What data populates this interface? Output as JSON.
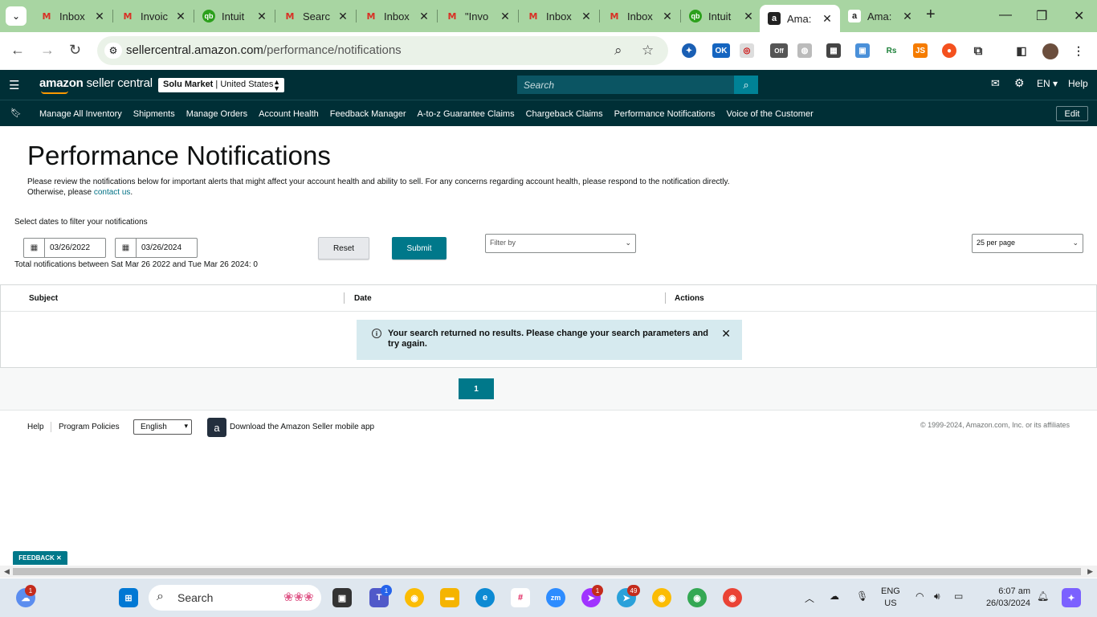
{
  "browser": {
    "tabs": [
      {
        "title": "Inbox",
        "favicon": "gmail-icon"
      },
      {
        "title": "Invoic",
        "favicon": "gmail-icon"
      },
      {
        "title": "Intuit",
        "favicon": "quickbooks-icon"
      },
      {
        "title": "Searc",
        "favicon": "gmail-icon"
      },
      {
        "title": "Inbox",
        "favicon": "gmail-icon"
      },
      {
        "title": "\"Invo",
        "favicon": "gmail-icon"
      },
      {
        "title": "Inbox",
        "favicon": "gmail-icon"
      },
      {
        "title": "Inbox",
        "favicon": "gmail-icon"
      },
      {
        "title": "Intuit",
        "favicon": "quickbooks-icon"
      },
      {
        "title": "Ama:",
        "favicon": "amazon-icon",
        "active": true
      },
      {
        "title": "Ama:",
        "favicon": "amazon-icon"
      }
    ],
    "url_domain": "sellercentral.amazon.com",
    "url_path": "/performance/notifications",
    "accent_color": "#a8d5a2"
  },
  "header": {
    "logo_bold": "amazon",
    "logo_rest": " seller central",
    "market_bold": "Solu Market",
    "market_sep": " | ",
    "market_region": "United States",
    "search_placeholder": "Search",
    "lang": "EN",
    "help": "Help",
    "bg_color": "#002f36"
  },
  "nav": {
    "links": [
      "Manage All Inventory",
      "Shipments",
      "Manage Orders",
      "Account Health",
      "Feedback Manager",
      "A-to-z Guarantee Claims",
      "Chargeback Claims",
      "Performance Notifications",
      "Voice of the Customer"
    ],
    "edit": "Edit"
  },
  "page": {
    "title": "Performance Notifications",
    "intro": "Please review the notifications below for important alerts that might affect your account health and ability to sell. For any concerns regarding account health, please respond to the notification directly. Otherwise, please ",
    "intro_link": "contact us",
    "intro_end": ".",
    "date_label": "Select dates to filter your notifications",
    "date_from": "03/26/2022",
    "date_to": "03/26/2024",
    "total": "Total notifications between Sat Mar 26 2022 and Tue Mar 26 2024: 0",
    "reset": "Reset",
    "submit": "Submit",
    "filter_placeholder": "Filter by",
    "per_page": "25 per page",
    "columns": [
      "Subject",
      "Date",
      "Actions"
    ],
    "no_results": "Your search returned no results. Please change your search parameters and try again.",
    "current_page": "1",
    "accent_color": "#00788a"
  },
  "footer": {
    "help": "Help",
    "policies": "Program Policies",
    "language": "English",
    "app_text": "Download the Amazon Seller mobile app",
    "copyright": "© 1999-2024, Amazon.com, Inc. or its affiliates",
    "feedback": "FEEDBACK"
  },
  "taskbar": {
    "search": "Search",
    "lang_top": "ENG",
    "lang_bottom": "US",
    "time": "6:07 am",
    "date": "26/03/2024",
    "badges": {
      "weather": "1",
      "teams": "1",
      "messenger": "1",
      "telegram": "49"
    }
  }
}
